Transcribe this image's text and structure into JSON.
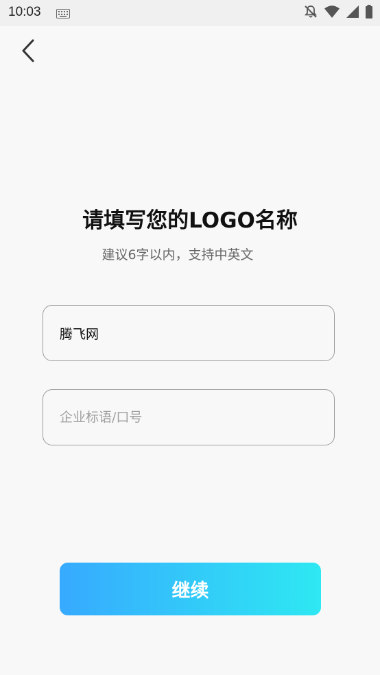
{
  "status_bar": {
    "time": "10:03",
    "icons": [
      "keyboard-icon",
      "notifications-off-icon",
      "wifi-icon",
      "signal-icon",
      "battery-icon"
    ]
  },
  "header": {
    "back_icon": "chevron-left-icon"
  },
  "main": {
    "title": "请填写您的LOGO名称",
    "subtitle": "建议6字以内，支持中英文"
  },
  "form": {
    "name_field": {
      "value": "腾飞网",
      "placeholder": ""
    },
    "slogan_field": {
      "value": "",
      "placeholder": "企业标语/口号"
    }
  },
  "actions": {
    "continue_label": "继续"
  },
  "colors": {
    "background": "#f8f8f8",
    "button_gradient_start": "#37aaff",
    "button_gradient_end": "#2ee8f2",
    "field_border": "#9b9b9b"
  }
}
